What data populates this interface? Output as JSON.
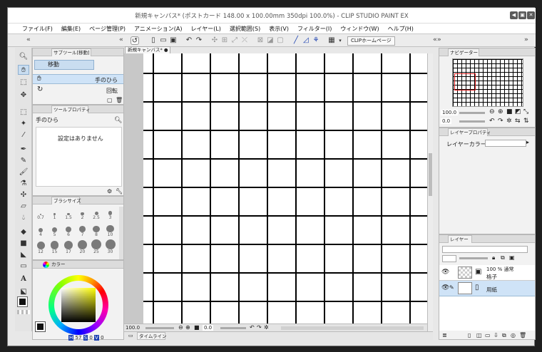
{
  "window": {
    "title": "新規キャンバス* (ポストカード 148.00 x 100.00mm 350dpi 100.0%) - CLIP STUDIO PAINT EX",
    "controls": [
      "◀",
      "▣",
      "✕"
    ]
  },
  "menu": [
    "ファイル(F)",
    "編集(E)",
    "ページ管理(P)",
    "アニメーション(A)",
    "レイヤー(L)",
    "選択範囲(S)",
    "表示(V)",
    "フィルター(I)",
    "ウィンドウ(W)",
    "ヘルプ(H)"
  ],
  "command_bar": {
    "clip_home": "CLIPホームページ"
  },
  "subtool_panel": {
    "tab": "サブツール[移動]",
    "active_group": "移動",
    "items": [
      {
        "label": "手のひら",
        "icon": "hand-icon"
      },
      {
        "label": "回転",
        "icon": "rotate-icon"
      }
    ]
  },
  "tool_property": {
    "tab": "ツールプロパティ",
    "tool_name": "手のひら",
    "message": "設定はありません"
  },
  "brush_size": {
    "tab": "ブラシサイズ",
    "sizes": [
      "0.7",
      "1",
      "1.5",
      "2",
      "2.5",
      "3",
      "4",
      "5",
      "6",
      "7",
      "8",
      "10",
      "12",
      "15",
      "17",
      "20",
      "25",
      "30"
    ]
  },
  "color_panel": {
    "tab": "カラー",
    "values": {
      "h_label": "H",
      "h": "57",
      "s_label": "S",
      "s": "0",
      "v_label": "V",
      "v": "0"
    }
  },
  "canvas": {
    "tab": "新規キャンバス*",
    "zoom": "100.0",
    "rotate": "0.0"
  },
  "timeline": {
    "tab": "タイムライン"
  },
  "navigator": {
    "tab": "ナビゲーター",
    "zoom": "100.0",
    "rotate": "0.0"
  },
  "layer_property": {
    "tab": "レイヤープロパティ",
    "layer_color_label": "レイヤーカラー"
  },
  "layers": {
    "tab": "レイヤー",
    "items": [
      {
        "opacity_mode": "100 % 通常",
        "name": "格子",
        "selected": false
      },
      {
        "opacity_mode": "",
        "name": "用紙",
        "selected": true
      }
    ]
  },
  "colors": {
    "accent": "#c9ddf0",
    "selection": "#cfe3f7",
    "dark_panel": "#2b2b2b"
  }
}
